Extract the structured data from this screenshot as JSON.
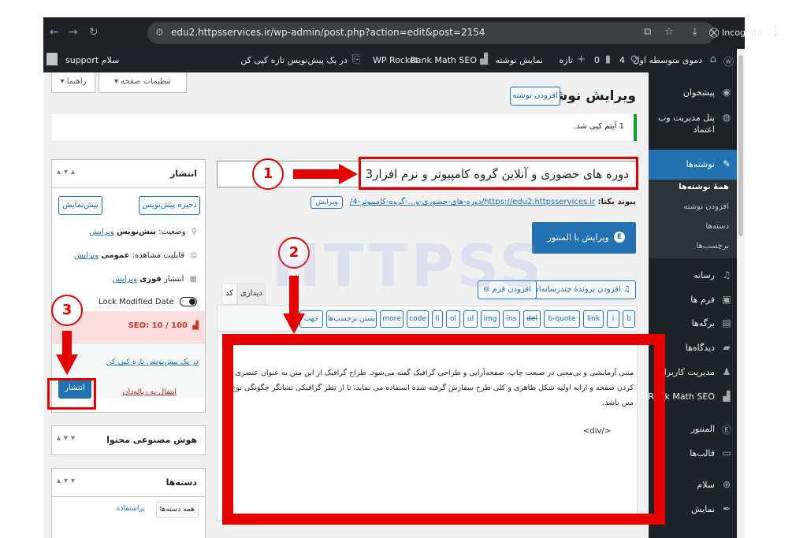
{
  "browser": {
    "url": "edu2.httpsservices.ir/wp-admin/post.php?action=edit&post=2154",
    "incognito_label": "Incognito"
  },
  "adminbar": {
    "site_name": "دموی متوسطه اول",
    "updates_count": "4",
    "comments_count": "0",
    "new_label": "تازه",
    "view_post": "نمایش نوشته",
    "rank_math": "Rank Math SEO",
    "wp_rocket": "WP Rocket",
    "copy_draft": "در یک پیش‌نویس تازه کپی کن",
    "greeting": "سلام support"
  },
  "sidebar": {
    "items": [
      {
        "label": "پیشخوان",
        "icon": "dashboard-icon"
      },
      {
        "label": "پنل مدیریت وب",
        "label2": "اعتماد",
        "icon": "web-panel-icon"
      },
      {
        "label": "نوشته‌ها",
        "icon": "pin-icon"
      },
      {
        "label": "رسانه",
        "icon": "media-icon"
      },
      {
        "label": "فرم ها",
        "icon": "form-icon"
      },
      {
        "label": "برگه‌ها",
        "icon": "page-icon"
      },
      {
        "label": "دیدگاه‌ها",
        "icon": "comment-icon"
      },
      {
        "label": "مدیریت کاربران",
        "icon": "users-icon"
      },
      {
        "label": "Rank Math SEO",
        "icon": "rankmath-icon"
      },
      {
        "label": "المنتور",
        "icon": "elementor-icon"
      },
      {
        "label": "قالب‌ها",
        "icon": "templates-icon"
      },
      {
        "label": "سلام",
        "icon": "plus-icon"
      },
      {
        "label": "نمایش",
        "icon": "appearance-icon"
      }
    ],
    "submenu": [
      "همهٔ نوشته‌ها",
      "افزودن نوشته",
      "دسته‌ها",
      "برچسب‌ها"
    ]
  },
  "screen": {
    "options": "تنظیمات صفحه ▾",
    "help": "راهنما ▾"
  },
  "page": {
    "title": "ویرایش نوشته",
    "add_new": "افزودن نوشته",
    "notice": "1 آیتم کپی شد."
  },
  "post": {
    "title": "دوره های حضوری و آنلاین گروه کامپیوتر و نرم افزار3",
    "permalink_label": "پیوند یکتا:",
    "permalink_url": "https://edu2.httpsservices.ir/دوره-های-حضوری-و...-گروه-کامپیوتر-4/",
    "permalink_edit": "ویرایش",
    "elementor_btn": "ویرایش با المنتور",
    "add_media": "افزودن پروندهٔ چندرسانه‌ای",
    "add_form": "افزودن فرم",
    "tab_visual": "دیداری",
    "tab_code": "کد",
    "content_line1": "متنی آزمایشی و بی‌معنی در صنعت چاپ، صفحه‌آرایی و طراحی گرافیک گفته می‌شود. طراح گرافیک از این متن به عنوان عنصری از ترکیب بندی برای پر",
    "content_line2": "کردن صفحه و ارایه اولیه شکل ظاهری و کلی طرح سفارش گرفته شده استفاده می نماید، تا از نظر گرافیکی نشانگر چگونگی نوع و اندازه فونت و ظاهر",
    "content_line3": "متن باشد.",
    "content_close": "<div/>"
  },
  "toolbar": [
    "b",
    "i",
    "link",
    "b-quote",
    "del",
    "ins",
    "img",
    "ul",
    "ol",
    "li",
    "code",
    "more",
    "بستن برچسب‌ها",
    "جهت"
  ],
  "publish": {
    "title": "انتشار",
    "save_draft": "ذخیره پیش‌نویس",
    "preview": "پیش‌نمایش",
    "status_label": "وضعیت:",
    "status_value": "پیش‌نویس",
    "visibility_label": "قابلیت مشاهده:",
    "visibility_value": "عمومی",
    "schedule_label": "انتشار",
    "schedule_value": "فوری",
    "edit": "ویرایش",
    "lock_modified": "Lock Modified Date",
    "seo_score": "SEO: 10 / 100",
    "copy_draft": "در یک پیش‌نویس تازه کپی کن",
    "trash": "انتقال به زباله‌دان",
    "publish_btn": "انتشار"
  },
  "ai_box": {
    "title": "هوش مصنوعی محتوا"
  },
  "categories_box": {
    "title": "دسته‌ها",
    "tab_all": "همه دسته‌ها",
    "tab_used": "پراستفاده"
  },
  "annotations": [
    "1",
    "2",
    "3"
  ],
  "watermark": "HTTPSS",
  "colors": {
    "accent": "#2271b1",
    "annotation": "#e60000",
    "sidebar": "#1d2327"
  }
}
